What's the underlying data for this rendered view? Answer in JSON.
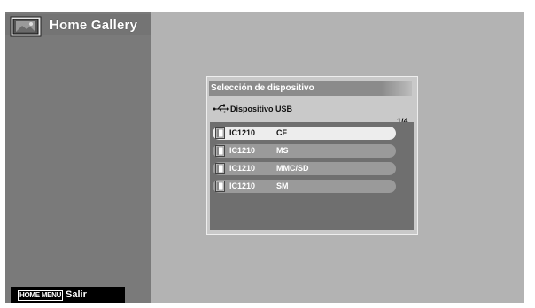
{
  "app": {
    "title": "Home Gallery",
    "icon": "photo-frame-icon"
  },
  "footer": {
    "key_label": "HOME MENU",
    "action_label": "Salir"
  },
  "dialog": {
    "title": "Selección de dispositivo",
    "source": {
      "icon": "usb-icon",
      "label": "Dispositivo USB"
    },
    "page_indicator": "1/4",
    "devices": [
      {
        "name": "IC1210",
        "slot": "CF",
        "selected": true
      },
      {
        "name": "IC1210",
        "slot": "MS",
        "selected": false
      },
      {
        "name": "IC1210",
        "slot": "MMC/SD",
        "selected": false
      },
      {
        "name": "IC1210",
        "slot": "SM",
        "selected": false
      }
    ]
  },
  "colors": {
    "screen_bg": "#b3b3b3",
    "sidebar_bg": "#7a7a7a",
    "selected_item": "#ededed",
    "unselected_item": "#9a9a9a"
  }
}
